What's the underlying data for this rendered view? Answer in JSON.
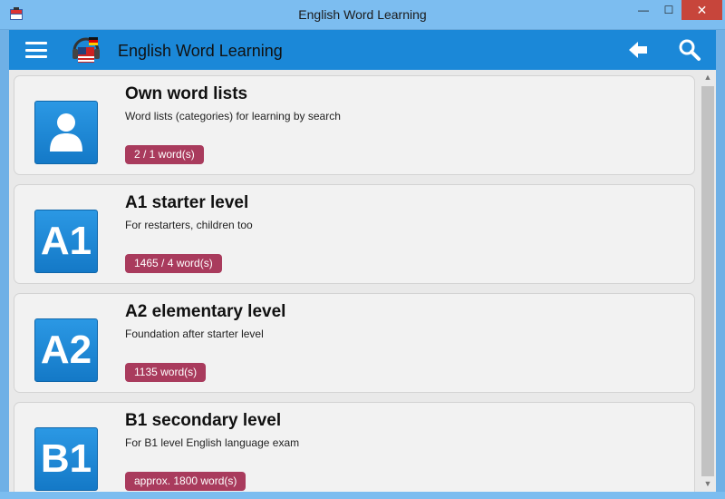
{
  "window": {
    "title": "English Word Learning",
    "controls": {
      "minimize": "—",
      "maximize": "☐",
      "close": "✕"
    }
  },
  "toolbar": {
    "title": "English Word Learning",
    "menu_icon": "hamburger-menu-icon",
    "back_icon": "back-arrow-icon",
    "search_icon": "search-icon"
  },
  "levels": [
    {
      "tile": "user-icon",
      "title": "Own word lists",
      "subtitle": "Word lists (categories) for learning by search",
      "badge": "2 / 1 word(s)"
    },
    {
      "tile": "A1",
      "title": "A1 starter level",
      "subtitle": "For restarters, children too",
      "badge": "1465 / 4 word(s)"
    },
    {
      "tile": "A2",
      "title": "A2 elementary level",
      "subtitle": "Foundation after starter level",
      "badge": "1135 word(s)"
    },
    {
      "tile": "B1",
      "title": "B1 secondary level",
      "subtitle": "For B1 level English language exam",
      "badge": "approx. 1800 word(s)"
    }
  ],
  "colors": {
    "toolbar": "#1b88d8",
    "tile": "#1b88d8",
    "badge": "#a93b5d",
    "titlebar": "#7cbdf0"
  }
}
